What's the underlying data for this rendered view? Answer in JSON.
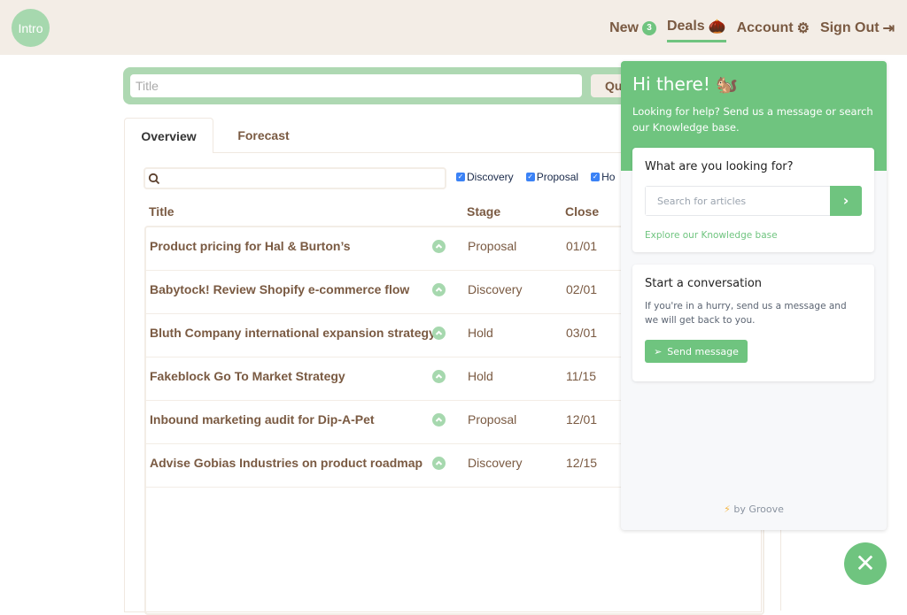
{
  "header": {
    "logo": "Intro",
    "nav": [
      {
        "label": "New",
        "badge": "3"
      },
      {
        "label": "Deals",
        "icon": "acorn-icon"
      },
      {
        "label": "Account",
        "icon": "gear-icon"
      },
      {
        "label": "Sign Out",
        "icon": "sign-out-icon"
      }
    ]
  },
  "topbar": {
    "title_placeholder": "Title",
    "button": "Qu"
  },
  "tabs": [
    "Overview",
    "Forecast"
  ],
  "filters": [
    "Discovery",
    "Proposal",
    "Ho"
  ],
  "columns": [
    "Title",
    "Stage",
    "Close"
  ],
  "rows": [
    {
      "title": "Product pricing for Hal & Burton’s",
      "stage": "Proposal",
      "close": "01/01"
    },
    {
      "title": "Babytock! Review Shopify e-commerce flow",
      "stage": "Discovery",
      "close": "02/01"
    },
    {
      "title": "Bluth Company international expansion strategy",
      "stage": "Hold",
      "close": "03/01"
    },
    {
      "title": "Fakeblock Go To Market Strategy",
      "stage": "Hold",
      "close": "11/15"
    },
    {
      "title": "Inbound marketing audit for Dip-A-Pet",
      "stage": "Proposal",
      "close": "12/01"
    },
    {
      "title": "Advise Gobias Industries on product roadmap",
      "stage": "Discovery",
      "close": "12/15"
    }
  ],
  "widget": {
    "greeting": "Hi there! 🐿️",
    "intro": "Looking for help? Send us a message or search our Knowledge base.",
    "search_heading": "What are you looking for?",
    "search_placeholder": "Search for articles",
    "explore": "Explore our Knowledge base",
    "conv_heading": "Start a conversation",
    "conv_text": "If you're in a hurry, send us a message and we will get back to you.",
    "send": "Send message",
    "footer": "by Groove",
    "accent": "#6fc47f"
  }
}
